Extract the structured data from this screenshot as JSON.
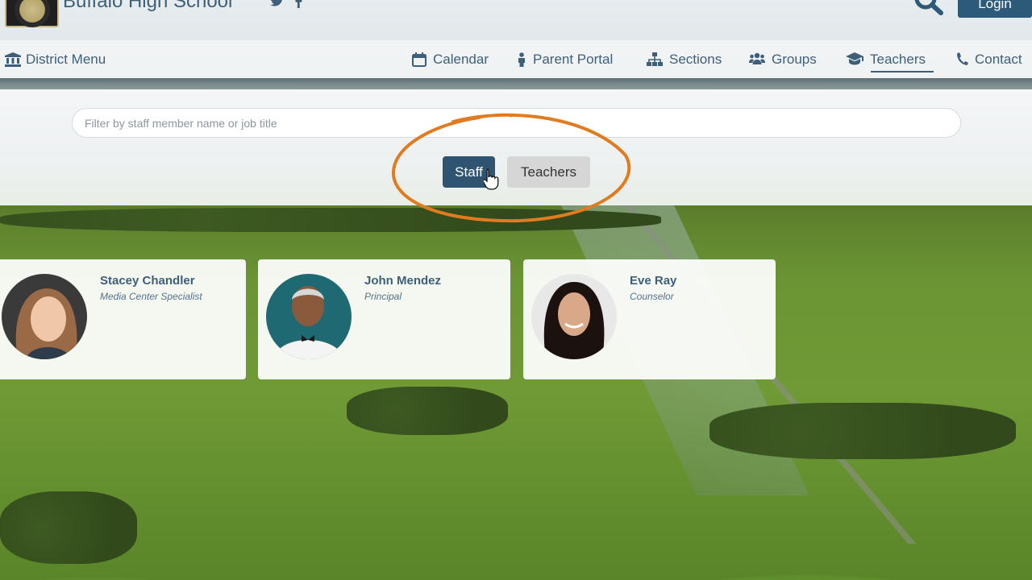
{
  "header": {
    "site_title": "Buffalo High School",
    "social": {
      "twitter": "twitter-icon",
      "facebook": "facebook-icon"
    },
    "search_icon": "search-icon",
    "login_label": "Login"
  },
  "nav": {
    "district_menu": "District Menu",
    "items": [
      {
        "label": "Calendar",
        "icon": "calendar-icon"
      },
      {
        "label": "Parent Portal",
        "icon": "person-icon"
      },
      {
        "label": "Sections",
        "icon": "sitemap-icon"
      },
      {
        "label": "Groups",
        "icon": "users-icon"
      },
      {
        "label": "Teachers",
        "icon": "graduation-cap-icon",
        "active": true
      },
      {
        "label": "Contact",
        "icon": "phone-icon"
      }
    ]
  },
  "filter": {
    "placeholder": "Filter by staff member name or job title",
    "buttons": [
      {
        "label": "Staff",
        "selected": true
      },
      {
        "label": "Teachers",
        "selected": false
      }
    ]
  },
  "staff": [
    {
      "name": "Stacey Chandler",
      "title": "Media Center Specialist"
    },
    {
      "name": "John Mendez",
      "title": "Principal"
    },
    {
      "name": "Eve Ray",
      "title": "Counselor"
    }
  ],
  "colors": {
    "brand": "#3e5f7a",
    "button_active": "#2f5472",
    "button_inactive": "#d6d6d6",
    "annotation": "#e07b1f"
  }
}
